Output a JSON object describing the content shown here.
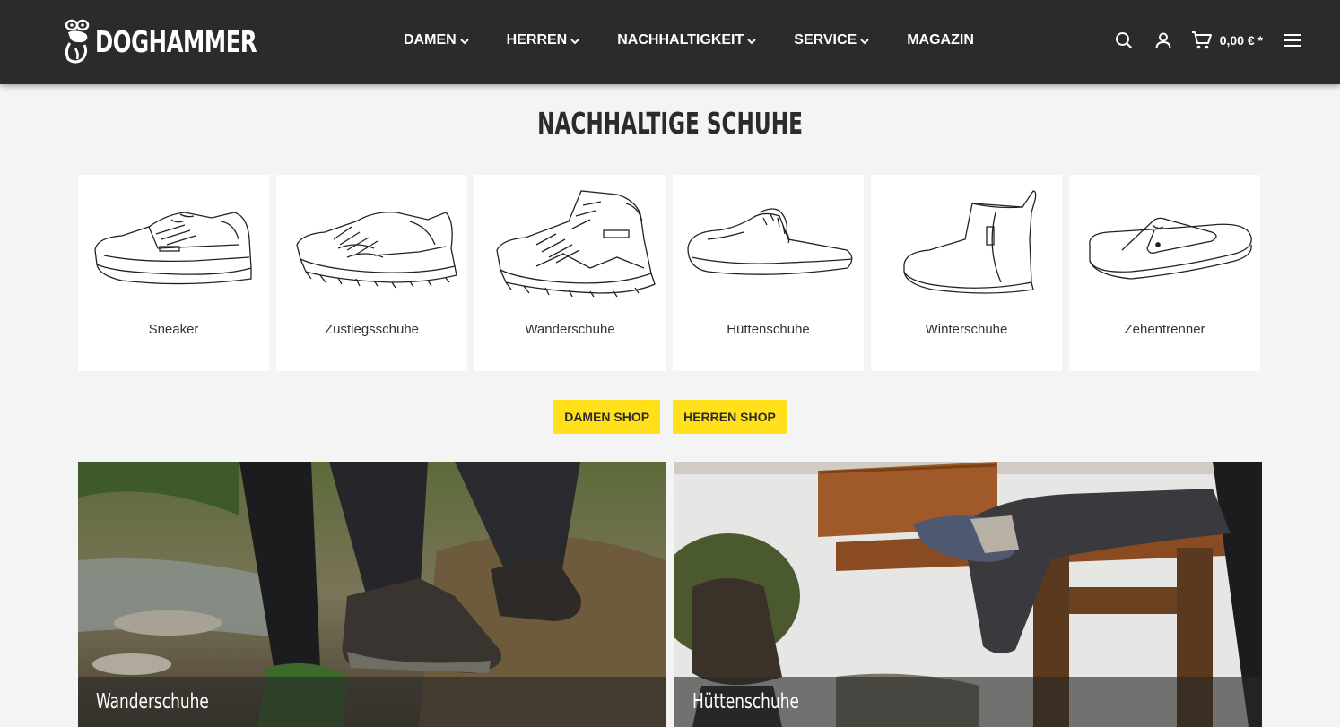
{
  "header": {
    "brand": "DOGHAMMER",
    "nav": [
      {
        "label": "DAMEN",
        "has_dropdown": true
      },
      {
        "label": "HERREN",
        "has_dropdown": true
      },
      {
        "label": "NACHHALTIGKEIT",
        "has_dropdown": true
      },
      {
        "label": "SERVICE",
        "has_dropdown": true
      },
      {
        "label": "MAGAZIN",
        "has_dropdown": false
      }
    ],
    "icons": [
      "search-icon",
      "account-icon",
      "cart-icon",
      "menu-icon"
    ],
    "cart_total": "0,00 € *"
  },
  "main": {
    "title": "NACHHALTIGE SCHUHE",
    "categories": [
      {
        "label": "Sneaker",
        "icon": "sneaker-drawing"
      },
      {
        "label": "Zustiegsschuhe",
        "icon": "approach-shoe-drawing"
      },
      {
        "label": "Wanderschuhe",
        "icon": "hiking-boot-drawing"
      },
      {
        "label": "Hüttenschuhe",
        "icon": "slipper-drawing"
      },
      {
        "label": "Winterschuhe",
        "icon": "winter-boot-drawing"
      },
      {
        "label": "Zehentrenner",
        "icon": "flip-flop-drawing"
      }
    ],
    "shop_buttons": [
      {
        "label": "DAMEN SHOP"
      },
      {
        "label": "HERREN SHOP"
      }
    ],
    "banners": [
      {
        "caption": "Wanderschuhe"
      },
      {
        "caption": "Hüttenschuhe"
      }
    ]
  },
  "colors": {
    "header_bg": "#2b2b2b",
    "page_bg": "#f4f4f4",
    "accent_yellow": "#ffe01a"
  }
}
